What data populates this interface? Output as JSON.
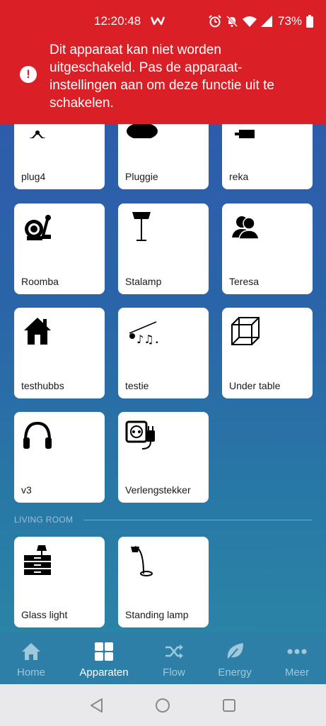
{
  "status_bar": {
    "time": "12:20:48",
    "battery": "73%",
    "icons": [
      "app-logo-icon",
      "alarm-icon",
      "bell-off-icon",
      "wifi-icon",
      "signal-icon",
      "battery-icon"
    ]
  },
  "banner": {
    "message": "Dit apparaat kan niet worden uitgeschakeld. Pas de apparaat-instellingen aan om deze functie uit te schakelen.",
    "icon": "alert-icon",
    "color": "#db1f26"
  },
  "devices": [
    {
      "label": "plug4",
      "icon": "plug-network-icon"
    },
    {
      "label": "Pluggie",
      "icon": "chat-bubble-icon"
    },
    {
      "label": "reka",
      "icon": "device-icon"
    },
    {
      "label": "Roomba",
      "icon": "vacuum-icon"
    },
    {
      "label": "Stalamp",
      "icon": "floor-lamp-icon"
    },
    {
      "label": "Teresa",
      "icon": "people-icon"
    },
    {
      "label": "testhubbs",
      "icon": "house-icon"
    },
    {
      "label": "testie",
      "icon": "music-conductor-icon"
    },
    {
      "label": "Under table",
      "icon": "cube-icon"
    },
    {
      "label": "v3",
      "icon": "headphones-icon"
    },
    {
      "label": "Verlengstekker",
      "icon": "socket-plug-icon"
    }
  ],
  "living_room": {
    "title": "LIVING ROOM",
    "devices": [
      {
        "label": "Glass light",
        "icon": "dresser-lamp-icon"
      },
      {
        "label": "Standing lamp",
        "icon": "arc-lamp-icon"
      }
    ]
  },
  "bottom_nav": [
    {
      "label": "Home",
      "icon": "home-icon",
      "active": false
    },
    {
      "label": "Apparaten",
      "icon": "grid-icon",
      "active": true
    },
    {
      "label": "Flow",
      "icon": "shuffle-icon",
      "active": false
    },
    {
      "label": "Energy",
      "icon": "leaf-icon",
      "active": false
    },
    {
      "label": "Meer",
      "icon": "more-icon",
      "active": false
    }
  ],
  "system_nav": [
    "back-icon",
    "home-circle-icon",
    "recents-icon"
  ]
}
